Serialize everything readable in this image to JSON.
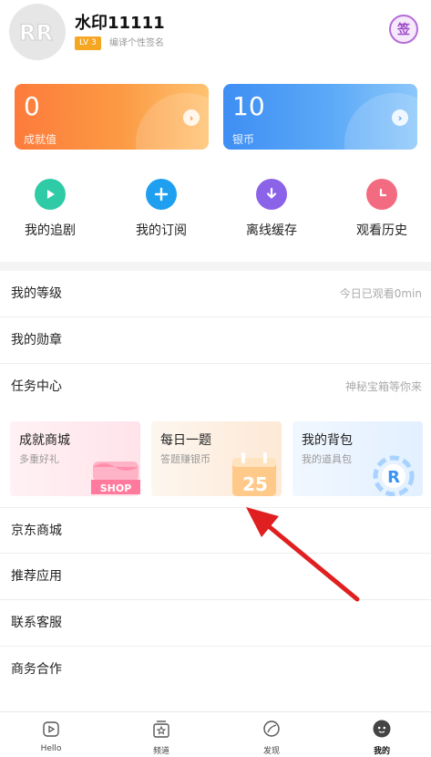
{
  "profile": {
    "username": "水印11111",
    "level": "LV 3",
    "signature": "编译个性签名",
    "sign_label": "签"
  },
  "stats": [
    {
      "value": "0",
      "label": "成就值",
      "color": "#fc8a40"
    },
    {
      "value": "10",
      "label": "银币",
      "color": "#4a9af5"
    }
  ],
  "quick_actions": [
    {
      "label": "我的追剧",
      "icon": "play-icon",
      "color": "#2fcaa6"
    },
    {
      "label": "我的订阅",
      "icon": "plus-icon",
      "color": "#1f9ff0"
    },
    {
      "label": "离线缓存",
      "icon": "download-icon",
      "color": "#8b63e8"
    },
    {
      "label": "观看历史",
      "icon": "clock-icon",
      "color": "#f36b80"
    }
  ],
  "menu": {
    "level": {
      "label": "我的等级",
      "hint": "今日已观看0min"
    },
    "medals": {
      "label": "我的勋章"
    },
    "tasks": {
      "label": "任务中心",
      "hint": "神秘宝箱等你来"
    },
    "jd": {
      "label": "京东商城"
    },
    "apps": {
      "label": "推荐应用"
    },
    "support": {
      "label": "联系客服"
    },
    "business": {
      "label": "商务合作"
    }
  },
  "promos": [
    {
      "title": "成就商城",
      "subtitle": "多重好礼",
      "art_text": "SHOP"
    },
    {
      "title": "每日一题",
      "subtitle": "答题赚银币",
      "art_text": "25"
    },
    {
      "title": "我的背包",
      "subtitle": "我的道具包",
      "art_text": "R"
    }
  ],
  "bottom_nav": [
    {
      "label": "Hello",
      "icon": "home-play-icon"
    },
    {
      "label": "频道",
      "icon": "channel-icon"
    },
    {
      "label": "发现",
      "icon": "discover-icon"
    },
    {
      "label": "我的",
      "icon": "profile-icon",
      "active": true
    }
  ],
  "annotation": {
    "color": "#e02020"
  }
}
